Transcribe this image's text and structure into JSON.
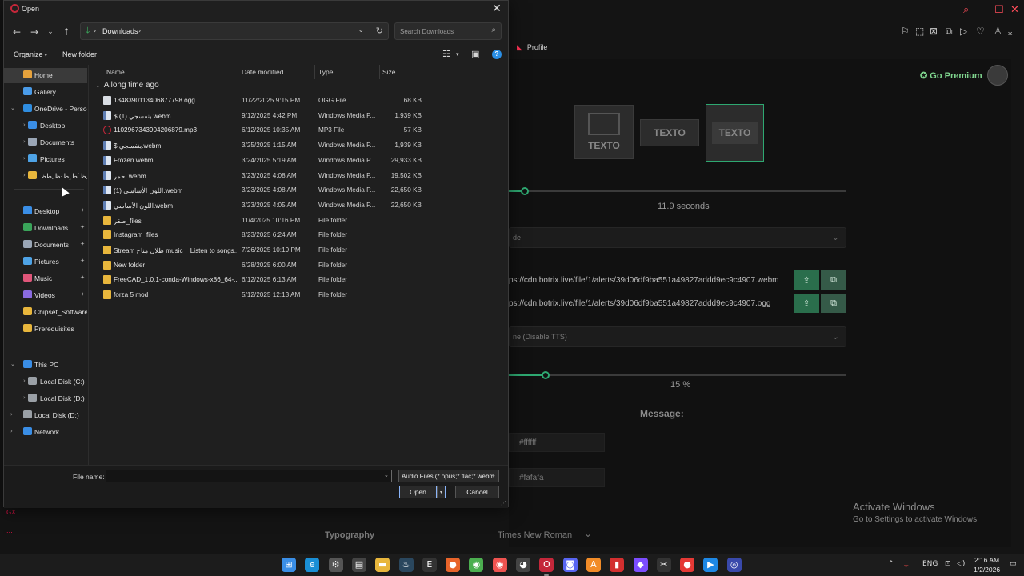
{
  "background_app": {
    "profile_label": "Profile",
    "go_premium": "Go Premium",
    "thumbnails": [
      "TEXTO",
      "TEXTO",
      "TEXTO"
    ],
    "duration_value": "11.9",
    "duration_unit": "seconds",
    "dropdown1_text": "de",
    "url_webm": "ps://cdn.botrix.live/file/1/alerts/39d06df9ba551a49827addd9ec9c4907.webm",
    "url_ogg": "ps://cdn.botrix.live/file/1/alerts/39d06df9ba551a49827addd9ec9c4907.ogg",
    "tts_select": "ne (Disable TTS)",
    "volume_value": "15",
    "volume_unit": "%",
    "volume_fraction": 0.15,
    "message_label": "Message:",
    "color1": "#ffffff",
    "color2": "#fafafa",
    "typography_label": "Typography",
    "typography_font": "Times New Roman",
    "activate_title": "Activate Windows",
    "activate_sub": "Go to Settings to activate Windows.",
    "left_strip": [
      "GX",
      "..."
    ]
  },
  "dialog": {
    "title": "Open",
    "close_glyph": "✕",
    "address": {
      "crumb_root_glyph": "›",
      "current": "Downloads",
      "crumb_end_glyph": "›"
    },
    "search_placeholder": "Search Downloads",
    "commands": {
      "organize": "Organize",
      "new_folder": "New folder"
    },
    "nav_pane": [
      {
        "label": "Home",
        "kind": "home",
        "indent": 0,
        "chevron": "",
        "pinned": false,
        "selected": true
      },
      {
        "label": "Gallery",
        "kind": "gallery",
        "indent": 0,
        "chevron": "",
        "pinned": false,
        "selected": false
      },
      {
        "label": "OneDrive - Persona",
        "kind": "cloud",
        "indent": 0,
        "chevron": "⌄",
        "pinned": false,
        "selected": false
      },
      {
        "label": "Desktop",
        "kind": "desktop",
        "indent": 1,
        "chevron": "›",
        "pinned": false,
        "selected": false
      },
      {
        "label": "Documents",
        "kind": "docs",
        "indent": 1,
        "chevron": "›",
        "pinned": false,
        "selected": false
      },
      {
        "label": "Pictures",
        "kind": "pics",
        "indent": 1,
        "chevron": "›",
        "pinned": false,
        "selected": false
      },
      {
        "label": "ط¹ظ„ظˆط¸ط·ظ„طظ",
        "kind": "folder",
        "indent": 1,
        "chevron": "›",
        "pinned": false,
        "selected": false
      },
      {
        "label": "Desktop",
        "kind": "desktop",
        "indent": 0,
        "chevron": "",
        "pinned": true,
        "selected": false
      },
      {
        "label": "Downloads",
        "kind": "downloads",
        "indent": 0,
        "chevron": "",
        "pinned": true,
        "selected": false
      },
      {
        "label": "Documents",
        "kind": "docs",
        "indent": 0,
        "chevron": "",
        "pinned": true,
        "selected": false
      },
      {
        "label": "Pictures",
        "kind": "pics",
        "indent": 0,
        "chevron": "",
        "pinned": true,
        "selected": false
      },
      {
        "label": "Music",
        "kind": "music",
        "indent": 0,
        "chevron": "",
        "pinned": true,
        "selected": false
      },
      {
        "label": "Videos",
        "kind": "videos",
        "indent": 0,
        "chevron": "",
        "pinned": true,
        "selected": false
      },
      {
        "label": "Chipset_Software",
        "kind": "folder",
        "indent": 0,
        "chevron": "",
        "pinned": false,
        "selected": false
      },
      {
        "label": "Prerequisites",
        "kind": "folder",
        "indent": 0,
        "chevron": "",
        "pinned": false,
        "selected": false
      },
      {
        "label": "This PC",
        "kind": "pc",
        "indent": 0,
        "chevron": "⌄",
        "pinned": false,
        "selected": false
      },
      {
        "label": "Local Disk (C:)",
        "kind": "disk",
        "indent": 1,
        "chevron": "›",
        "pinned": false,
        "selected": false
      },
      {
        "label": "Local Disk (D:)",
        "kind": "disk",
        "indent": 1,
        "chevron": "›",
        "pinned": false,
        "selected": false
      },
      {
        "label": "Local Disk (D:)",
        "kind": "disk",
        "indent": 0,
        "chevron": "›",
        "pinned": false,
        "selected": false
      },
      {
        "label": "Network",
        "kind": "network",
        "indent": 0,
        "chevron": "›",
        "pinned": false,
        "selected": false
      }
    ],
    "columns": {
      "name": "Name",
      "date": "Date modified",
      "type": "Type",
      "size": "Size"
    },
    "group_label": "A long time ago",
    "files": [
      {
        "name": "1348390113406877798.ogg",
        "date": "11/22/2025 9:15 PM",
        "type": "OGG File",
        "size": "68 KB",
        "kind": "file"
      },
      {
        "name": "$ بنفسجي (1).webm",
        "date": "9/12/2025 4:42 PM",
        "type": "Windows Media P...",
        "size": "1,939 KB",
        "kind": "media"
      },
      {
        "name": "1102967343904206879.mp3",
        "date": "6/12/2025 10:35 AM",
        "type": "MP3 File",
        "size": "57 KB",
        "kind": "mp3"
      },
      {
        "name": "$ بنفسجي.webm",
        "date": "3/25/2025 1:15 AM",
        "type": "Windows Media P...",
        "size": "1,939 KB",
        "kind": "media"
      },
      {
        "name": "Frozen.webm",
        "date": "3/24/2025 5:19 AM",
        "type": "Windows Media P...",
        "size": "29,933 KB",
        "kind": "media"
      },
      {
        "name": "احمر.webm",
        "date": "3/23/2025 4:08 AM",
        "type": "Windows Media P...",
        "size": "19,502 KB",
        "kind": "media"
      },
      {
        "name": "اللون الأساسي (1).webm",
        "date": "3/23/2025 4:08 AM",
        "type": "Windows Media P...",
        "size": "22,650 KB",
        "kind": "media"
      },
      {
        "name": "اللون الأساسي.webm",
        "date": "3/23/2025 4:05 AM",
        "type": "Windows Media P...",
        "size": "22,650 KB",
        "kind": "media"
      },
      {
        "name": "صقر_files",
        "date": "11/4/2025 10:16 PM",
        "type": "File folder",
        "size": "",
        "kind": "folder"
      },
      {
        "name": "Instagram_files",
        "date": "8/23/2025 6:24 AM",
        "type": "File folder",
        "size": "",
        "kind": "folder"
      },
      {
        "name": "Stream طلال مناح music _ Listen to songs...",
        "date": "7/26/2025 10:19 PM",
        "type": "File folder",
        "size": "",
        "kind": "folder"
      },
      {
        "name": "New folder",
        "date": "6/28/2025 6:00 AM",
        "type": "File folder",
        "size": "",
        "kind": "folder"
      },
      {
        "name": "FreeCAD_1.0.1-conda-Windows-x86_64-...",
        "date": "6/12/2025 6:13 AM",
        "type": "File folder",
        "size": "",
        "kind": "folder"
      },
      {
        "name": "forza 5 mod",
        "date": "5/12/2025 12:13 AM",
        "type": "File folder",
        "size": "",
        "kind": "folder"
      }
    ],
    "file_name_label": "File name:",
    "file_name_value": "",
    "filter_value": "Audio Files (*.opus;*.flac;*.webm",
    "open_label": "Open",
    "cancel_label": "Cancel"
  },
  "taskbar": {
    "apps": [
      {
        "name": "start",
        "glyph": "⊞",
        "color": "#3a8ee6"
      },
      {
        "name": "edge",
        "glyph": "e",
        "color": "#1a8fd6"
      },
      {
        "name": "settings",
        "glyph": "⚙",
        "color": "#555555"
      },
      {
        "name": "store",
        "glyph": "▤",
        "color": "#444444"
      },
      {
        "name": "file-explorer",
        "glyph": "▬",
        "color": "#e8b63c"
      },
      {
        "name": "steam",
        "glyph": "♨",
        "color": "#2a475e"
      },
      {
        "name": "epic",
        "glyph": "E",
        "color": "#333333"
      },
      {
        "name": "app-orange",
        "glyph": "●",
        "color": "#e8642a"
      },
      {
        "name": "chrome",
        "glyph": "◉",
        "color": "#4caf50"
      },
      {
        "name": "chrome-2",
        "glyph": "◉",
        "color": "#ef5350"
      },
      {
        "name": "github",
        "glyph": "◕",
        "color": "#444444"
      },
      {
        "name": "opera-gx",
        "glyph": "O",
        "color": "#c4273a"
      },
      {
        "name": "discord",
        "glyph": "◙",
        "color": "#5865f2"
      },
      {
        "name": "app-a",
        "glyph": "A",
        "color": "#f28c28"
      },
      {
        "name": "app-red",
        "glyph": "▮",
        "color": "#d32f2f"
      },
      {
        "name": "app-diamond",
        "glyph": "◆",
        "color": "#7c4dff"
      },
      {
        "name": "capcut",
        "glyph": "✂",
        "color": "#333333"
      },
      {
        "name": "app-rec",
        "glyph": "●",
        "color": "#e53935"
      },
      {
        "name": "app-blue",
        "glyph": "▶",
        "color": "#1e88e5"
      },
      {
        "name": "app-net",
        "glyph": "◎",
        "color": "#3949ab"
      }
    ],
    "lang": "ENG",
    "time": "2:16 AM",
    "date": "1/2/2026"
  }
}
